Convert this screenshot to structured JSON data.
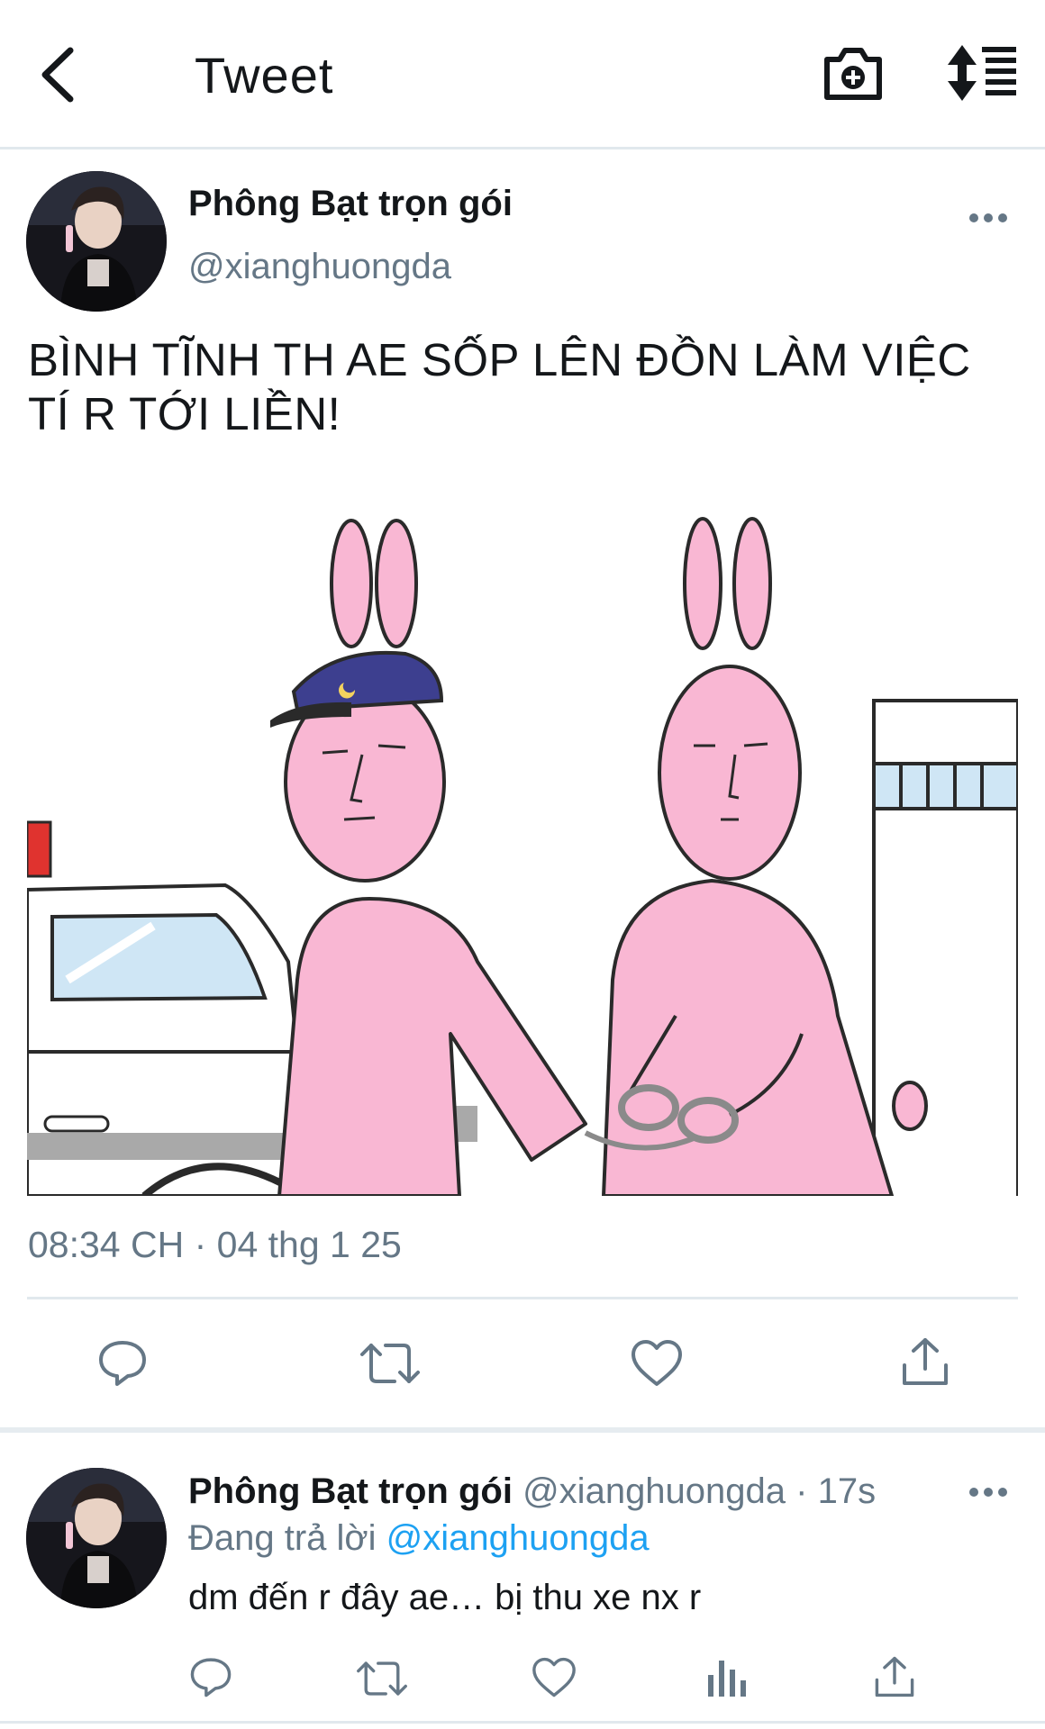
{
  "header": {
    "title": "Tweet",
    "back_icon": "chevron-left-icon",
    "camera_icon": "camera-plus-icon",
    "sort_icon": "sort-list-icon"
  },
  "tweet": {
    "author_name": "Phông Bạt trọn gói",
    "author_handle": "@xianghuongda",
    "text_line1": "BÌNH TĨNH TH AE SỐP LÊN ĐỒN LÀM VIỆC",
    "text_line2": "TÍ R TỚI LIỀN!",
    "timestamp": "08:34 CH · 04 thg 1 25",
    "actions": [
      "reply-icon",
      "retweet-icon",
      "like-icon",
      "share-icon"
    ]
  },
  "reply": {
    "author_name": "Phông Bạt trọn gói",
    "meta": "@xianghuongda · 17s",
    "replying_prefix": "Đang trả lời",
    "replying_to": "@xianghuongda",
    "text": "dm đến r đây ae… bị thu xe nx r",
    "actions": [
      "reply-icon",
      "retweet-icon",
      "like-icon",
      "analytics-icon",
      "share-icon"
    ]
  },
  "colors": {
    "text": "#14171a",
    "secondary": "#657786",
    "accent": "#1da1f2",
    "divider": "#e1e8ed",
    "rabbit_pink": "#f9b7d3"
  }
}
